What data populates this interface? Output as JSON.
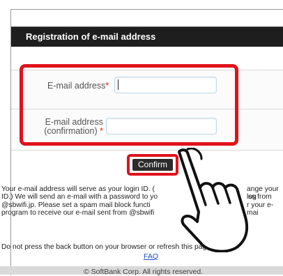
{
  "header": {
    "title": "Registration of e-mail address"
  },
  "form": {
    "email_label": "E-mail address",
    "email_required_mark": "*",
    "email_value": "",
    "confirm_label_line1": "E-mail address",
    "confirm_label_line2": "(confirmation)",
    "confirm_required_mark": "*",
    "confirm_value": ""
  },
  "actions": {
    "confirm_label": "Confirm"
  },
  "notice": {
    "line1": "Your e-mail address will serve as your login ID. (",
    "line1_end": "ange your log",
    "line2": "ID.) We will send an e-mail with a password to yo",
    "line2_end": "ss from",
    "line3": "@sbwifi.jp. Please set a spam mail block functi",
    "line3_end": "r your e-mai",
    "line4": "program to receive our e-mail sent from @sbwifi"
  },
  "warning": "Do not press the back button on your browser or refresh this page",
  "faq_label": "FAQ",
  "footer": "© SoftBank Corp. All rights reserved.",
  "colors": {
    "highlight": "#e0121b",
    "titlebar": "#1e1e1e",
    "link": "#1a4fbf"
  },
  "icons": {
    "pointer": "pointing-hand-icon"
  }
}
